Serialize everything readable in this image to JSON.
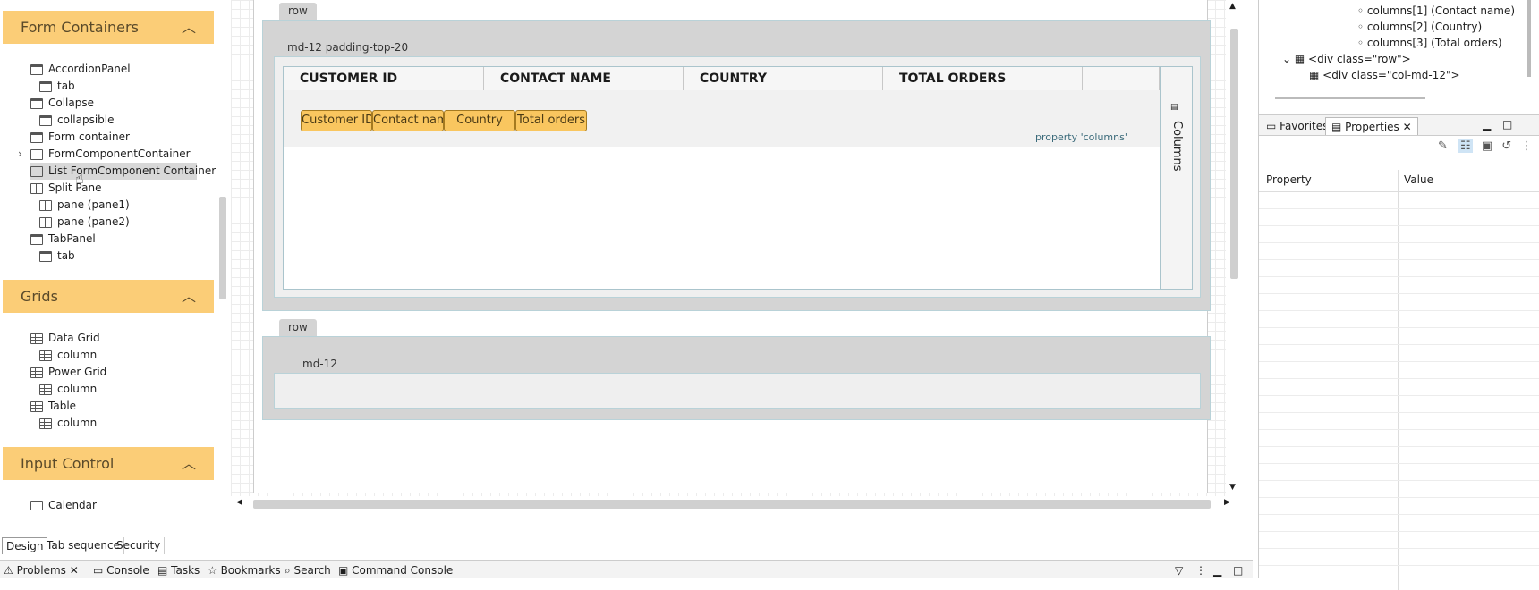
{
  "palette": {
    "sections": [
      {
        "title": "Form Containers",
        "collapse": "︿"
      },
      {
        "title": "Grids",
        "collapse": "︿"
      },
      {
        "title": "Input Control",
        "collapse": "︿"
      }
    ],
    "form_containers": [
      {
        "label": "AccordionPanel",
        "icon": "folder-icon"
      },
      {
        "label": "tab",
        "icon": "folder-icon"
      },
      {
        "label": "Collapse",
        "icon": "folder-icon"
      },
      {
        "label": "collapsible",
        "icon": "folder-icon"
      },
      {
        "label": "Form container",
        "icon": "folder-icon"
      },
      {
        "label": "FormComponentContainer",
        "icon": "form-component-icon"
      },
      {
        "label": "List FormComponent Container",
        "icon": "form-component-icon"
      },
      {
        "label": "Split Pane",
        "icon": "split-pane-icon"
      },
      {
        "label": "pane (pane1)",
        "icon": "split-pane-icon"
      },
      {
        "label": "pane (pane2)",
        "icon": "split-pane-icon"
      },
      {
        "label": "TabPanel",
        "icon": "folder-icon"
      },
      {
        "label": "tab",
        "icon": "folder-icon"
      }
    ],
    "grids": [
      {
        "label": "Data Grid",
        "icon": "data-grid-icon"
      },
      {
        "label": "column",
        "icon": "data-grid-icon"
      },
      {
        "label": "Power Grid",
        "icon": "data-grid-icon"
      },
      {
        "label": "column",
        "icon": "data-grid-icon"
      },
      {
        "label": "Table",
        "icon": "table-icon"
      },
      {
        "label": "column",
        "icon": "table-icon"
      }
    ],
    "input_control": [
      {
        "label": "Calendar",
        "icon": "calendar-icon"
      }
    ]
  },
  "canvas": {
    "row1_tag": "row",
    "md12_tag": "md-12 padding-top-20",
    "headers": [
      "CUSTOMER ID",
      "CONTACT NAME",
      "COUNTRY",
      "TOTAL ORDERS"
    ],
    "chips": [
      "Customer ID",
      "Contact nam",
      "Country",
      "Total orders"
    ],
    "property_hint": "property 'columns'",
    "side_label": "Columns",
    "row2_tag": "row",
    "md12b_tag": "md-12"
  },
  "bottom_tabs": [
    "Design",
    "Tab sequence",
    "Security"
  ],
  "problems_bar": [
    "Problems",
    "Console",
    "Tasks",
    "Bookmarks",
    "Search",
    "Command Console"
  ],
  "outline": {
    "items": [
      "columns[1] (Contact name)",
      "columns[2] (Country)",
      "columns[3] (Total orders)",
      "<div class=\"row\">",
      "<div class=\"col-md-12\">"
    ]
  },
  "props": {
    "tabs": [
      "Favorites",
      "Properties"
    ],
    "col_property": "Property",
    "col_value": "Value"
  }
}
